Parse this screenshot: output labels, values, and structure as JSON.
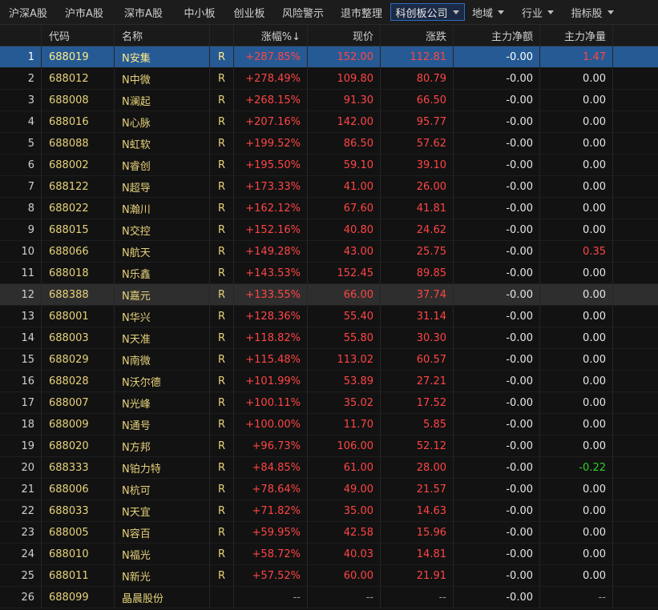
{
  "tabs": [
    {
      "label": "沪深A股"
    },
    {
      "label": "沪市A股"
    },
    {
      "label": "深市A股"
    },
    {
      "label": "中小板"
    },
    {
      "label": "创业板"
    },
    {
      "label": "风险警示"
    },
    {
      "label": "退市整理"
    },
    {
      "label": "科创板公司",
      "active": true,
      "dropdown": true
    },
    {
      "label": "地域",
      "dropdown": true
    },
    {
      "label": "行业",
      "dropdown": true
    },
    {
      "label": "指标股",
      "dropdown": true
    }
  ],
  "columns": {
    "idx": "",
    "code": "代码",
    "name": "名称",
    "r": "",
    "pct": "涨幅%↓",
    "price": "现价",
    "chg": "涨跌",
    "net": "主力净额",
    "vol": "主力净量"
  },
  "colors": {
    "up": "#ff4545",
    "down": "#28d228",
    "code": "#e7d27a",
    "selected": "#265a94"
  },
  "rows": [
    {
      "idx": "1",
      "code": "688019",
      "name": "N安集",
      "r": "R",
      "pct": "+287.85%",
      "price": "152.00",
      "chg": "112.81",
      "net": "-0.00",
      "vol": "1.47",
      "vol_color": "red",
      "state": "sel"
    },
    {
      "idx": "2",
      "code": "688012",
      "name": "N中微",
      "r": "R",
      "pct": "+278.49%",
      "price": "109.80",
      "chg": "80.79",
      "net": "-0.00",
      "vol": "0.00"
    },
    {
      "idx": "3",
      "code": "688008",
      "name": "N澜起",
      "r": "R",
      "pct": "+268.15%",
      "price": "91.30",
      "chg": "66.50",
      "net": "-0.00",
      "vol": "0.00"
    },
    {
      "idx": "4",
      "code": "688016",
      "name": "N心脉",
      "r": "R",
      "pct": "+207.16%",
      "price": "142.00",
      "chg": "95.77",
      "net": "-0.00",
      "vol": "0.00"
    },
    {
      "idx": "5",
      "code": "688088",
      "name": "N虹软",
      "r": "R",
      "pct": "+199.52%",
      "price": "86.50",
      "chg": "57.62",
      "net": "-0.00",
      "vol": "0.00"
    },
    {
      "idx": "6",
      "code": "688002",
      "name": "N睿创",
      "r": "R",
      "pct": "+195.50%",
      "price": "59.10",
      "chg": "39.10",
      "net": "-0.00",
      "vol": "0.00"
    },
    {
      "idx": "7",
      "code": "688122",
      "name": "N超导",
      "r": "R",
      "pct": "+173.33%",
      "price": "41.00",
      "chg": "26.00",
      "net": "-0.00",
      "vol": "0.00"
    },
    {
      "idx": "8",
      "code": "688022",
      "name": "N瀚川",
      "r": "R",
      "pct": "+162.12%",
      "price": "67.60",
      "chg": "41.81",
      "net": "-0.00",
      "vol": "0.00"
    },
    {
      "idx": "9",
      "code": "688015",
      "name": "N交控",
      "r": "R",
      "pct": "+152.16%",
      "price": "40.80",
      "chg": "24.62",
      "net": "-0.00",
      "vol": "0.00"
    },
    {
      "idx": "10",
      "code": "688066",
      "name": "N航天",
      "r": "R",
      "pct": "+149.28%",
      "price": "43.00",
      "chg": "25.75",
      "net": "-0.00",
      "vol": "0.35",
      "vol_color": "red"
    },
    {
      "idx": "11",
      "code": "688018",
      "name": "N乐鑫",
      "r": "R",
      "pct": "+143.53%",
      "price": "152.45",
      "chg": "89.85",
      "net": "-0.00",
      "vol": "0.00"
    },
    {
      "idx": "12",
      "code": "688388",
      "name": "N嘉元",
      "r": "R",
      "pct": "+133.55%",
      "price": "66.00",
      "chg": "37.74",
      "net": "-0.00",
      "vol": "0.00",
      "state": "hl"
    },
    {
      "idx": "13",
      "code": "688001",
      "name": "N华兴",
      "r": "R",
      "pct": "+128.36%",
      "price": "55.40",
      "chg": "31.14",
      "net": "-0.00",
      "vol": "0.00"
    },
    {
      "idx": "14",
      "code": "688003",
      "name": "N天准",
      "r": "R",
      "pct": "+118.82%",
      "price": "55.80",
      "chg": "30.30",
      "net": "-0.00",
      "vol": "0.00"
    },
    {
      "idx": "15",
      "code": "688029",
      "name": "N南微",
      "r": "R",
      "pct": "+115.48%",
      "price": "113.02",
      "chg": "60.57",
      "net": "-0.00",
      "vol": "0.00"
    },
    {
      "idx": "16",
      "code": "688028",
      "name": "N沃尔德",
      "r": "R",
      "pct": "+101.99%",
      "price": "53.89",
      "chg": "27.21",
      "net": "-0.00",
      "vol": "0.00"
    },
    {
      "idx": "17",
      "code": "688007",
      "name": "N光峰",
      "r": "R",
      "pct": "+100.11%",
      "price": "35.02",
      "chg": "17.52",
      "net": "-0.00",
      "vol": "0.00"
    },
    {
      "idx": "18",
      "code": "688009",
      "name": "N通号",
      "r": "R",
      "pct": "+100.00%",
      "price": "11.70",
      "chg": "5.85",
      "net": "-0.00",
      "vol": "0.00"
    },
    {
      "idx": "19",
      "code": "688020",
      "name": "N方邦",
      "r": "R",
      "pct": "+96.73%",
      "price": "106.00",
      "chg": "52.12",
      "net": "-0.00",
      "vol": "0.00"
    },
    {
      "idx": "20",
      "code": "688333",
      "name": "N铂力特",
      "r": "R",
      "pct": "+84.85%",
      "price": "61.00",
      "chg": "28.00",
      "net": "-0.00",
      "vol": "-0.22",
      "vol_color": "green"
    },
    {
      "idx": "21",
      "code": "688006",
      "name": "N杭可",
      "r": "R",
      "pct": "+78.64%",
      "price": "49.00",
      "chg": "21.57",
      "net": "-0.00",
      "vol": "0.00"
    },
    {
      "idx": "22",
      "code": "688033",
      "name": "N天宜",
      "r": "R",
      "pct": "+71.82%",
      "price": "35.00",
      "chg": "14.63",
      "net": "-0.00",
      "vol": "0.00"
    },
    {
      "idx": "23",
      "code": "688005",
      "name": "N容百",
      "r": "R",
      "pct": "+59.95%",
      "price": "42.58",
      "chg": "15.96",
      "net": "-0.00",
      "vol": "0.00"
    },
    {
      "idx": "24",
      "code": "688010",
      "name": "N福光",
      "r": "R",
      "pct": "+58.72%",
      "price": "40.03",
      "chg": "14.81",
      "net": "-0.00",
      "vol": "0.00"
    },
    {
      "idx": "25",
      "code": "688011",
      "name": "N新光",
      "r": "R",
      "pct": "+57.52%",
      "price": "60.00",
      "chg": "21.91",
      "net": "-0.00",
      "vol": "0.00"
    },
    {
      "idx": "26",
      "code": "688099",
      "name": "晶晨股份",
      "r": "",
      "pct": "--",
      "price": "--",
      "chg": "--",
      "net": "-0.00",
      "vol": "--",
      "pct_color": "gray",
      "vol_color": "gray"
    }
  ]
}
